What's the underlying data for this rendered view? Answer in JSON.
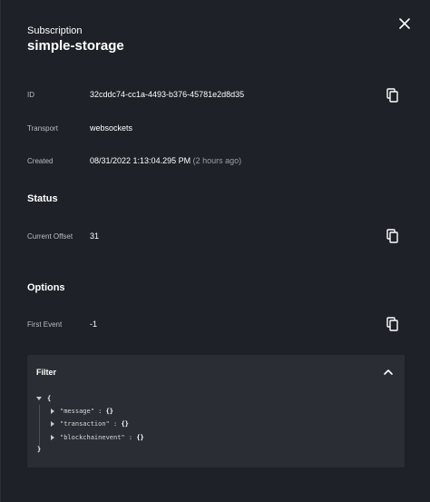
{
  "header": {
    "eyebrow": "Subscription",
    "title": "simple-storage",
    "close_icon": "close-icon"
  },
  "details": {
    "id_label": "ID",
    "id_value": "32cddc74-cc1a-4493-b376-45781e2d8d35",
    "transport_label": "Transport",
    "transport_value": "websockets",
    "created_label": "Created",
    "created_value": "08/31/2022 1:13:04.295 PM",
    "created_relative": "(2 hours ago)"
  },
  "status": {
    "section_title": "Status",
    "offset_label": "Current Offset",
    "offset_value": "31"
  },
  "options": {
    "section_title": "Options",
    "first_event_label": "First Event",
    "first_event_value": "-1"
  },
  "filter": {
    "title": "Filter",
    "open_brace": "{",
    "close_brace": "}",
    "entries": [
      {
        "key": "\"message\"",
        "sep": " : ",
        "value": "{}"
      },
      {
        "key": "\"transaction\"",
        "sep": " : ",
        "value": "{}"
      },
      {
        "key": "\"blockchainevent\"",
        "sep": " : ",
        "value": "{}"
      }
    ]
  },
  "colors": {
    "background": "#1e2127",
    "filter_background": "#2a2d33",
    "label": "#b8bdc5",
    "muted": "#9aa0a8"
  }
}
